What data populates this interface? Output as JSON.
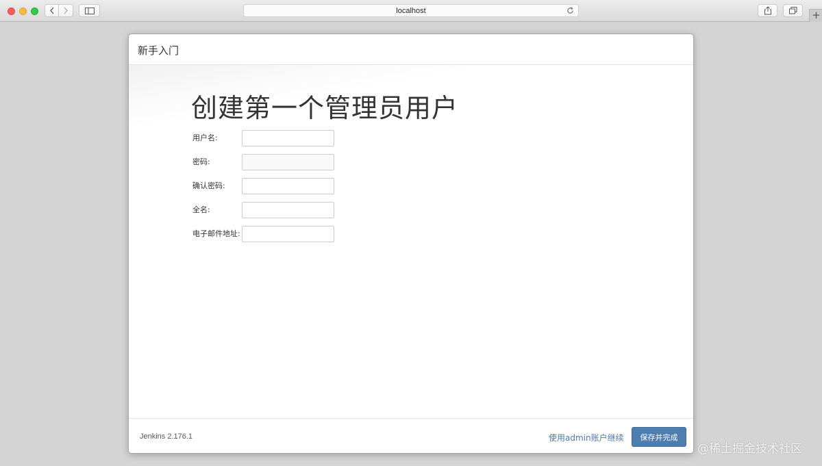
{
  "browser": {
    "url": "localhost",
    "new_tab_label": "+"
  },
  "dialog": {
    "title": "新手入门",
    "heading": "创建第一个管理员用户",
    "fields": [
      {
        "label": "用户名:",
        "value": ""
      },
      {
        "label": "密码:",
        "value": ""
      },
      {
        "label": "确认密码:",
        "value": ""
      },
      {
        "label": "全名:",
        "value": ""
      },
      {
        "label": "电子邮件地址:",
        "value": ""
      }
    ],
    "footer": {
      "version": "Jenkins 2.176.1",
      "continue_link": "使用admin账户继续",
      "save_button": "保存并完成"
    }
  },
  "watermark": "@稀土掘金技术社区",
  "colors": {
    "primary_button": "#4e7eaf",
    "link": "#4e79a7",
    "close_dot": "#fc605c",
    "minimize_dot": "#fdbc40",
    "zoom_dot": "#34c84a"
  }
}
